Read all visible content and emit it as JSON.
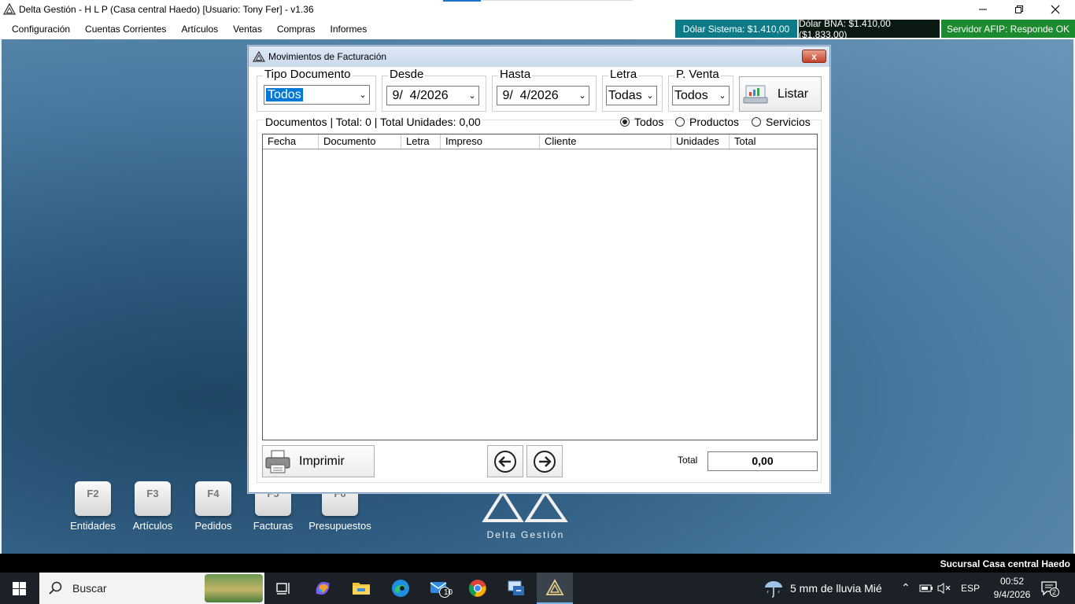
{
  "window": {
    "title": "Delta Gestión - H L P (Casa central Haedo) [Usuario: Tony Fer] - v1.36"
  },
  "menu": [
    "Configuración",
    "Cuentas Corrientes",
    "Artículos",
    "Ventas",
    "Compras",
    "Informes"
  ],
  "status": {
    "dolar_sistema": "Dólar Sistema: $1.410,00",
    "dolar_bna": "Dólar BNA: $1.410,00 ($1.833,00)",
    "servidor_afip": "Servidor AFIP:  Responde OK",
    "colors": {
      "dolar_sistema": "#0f7a87",
      "dolar_bna": "#0a1a12",
      "servidor_afip": "#1c8a2e"
    }
  },
  "dialog": {
    "title": "Movimientos de Facturación",
    "close_label": "x",
    "filters": {
      "tipo_documento": {
        "label": "Tipo Documento",
        "value": "Todos"
      },
      "desde": {
        "label": "Desde",
        "value": " 9/  4/2026"
      },
      "hasta": {
        "label": "Hasta",
        "value": " 9/  4/2026"
      },
      "letra": {
        "label": "Letra",
        "value": "Todas"
      },
      "p_venta": {
        "label": "P. Venta",
        "value": "Todos"
      }
    },
    "listar_label": "Listar",
    "summary": "Documentos | Total: 0 | Total Unidades: 0,00",
    "radios": [
      {
        "label": "Todos",
        "checked": true
      },
      {
        "label": "Productos",
        "checked": false
      },
      {
        "label": "Servicios",
        "checked": false
      }
    ],
    "columns": [
      "Fecha",
      "Documento",
      "Letra",
      "Impreso",
      "Cliente",
      "Unidades",
      "Total"
    ],
    "rows": [],
    "imprimir_label": "Imprimir",
    "total_label": "Total",
    "total_value": "0,00"
  },
  "shortcuts": [
    {
      "key": "F2",
      "label": "Entidades"
    },
    {
      "key": "F3",
      "label": "Artículos"
    },
    {
      "key": "F4",
      "label": "Pedidos"
    },
    {
      "key": "F5",
      "label": "Facturas"
    },
    {
      "key": "F6",
      "label": "Presupuestos"
    }
  ],
  "brand": "Delta Gestión",
  "sucursal": "Sucursal Casa central Haedo",
  "taskbar": {
    "search_placeholder": "Buscar",
    "mail_badge": "10",
    "weather": "5 mm de lluvia Mié",
    "language": "ESP",
    "time": "00:52",
    "date": "9/4/2026",
    "notifications": "2"
  }
}
